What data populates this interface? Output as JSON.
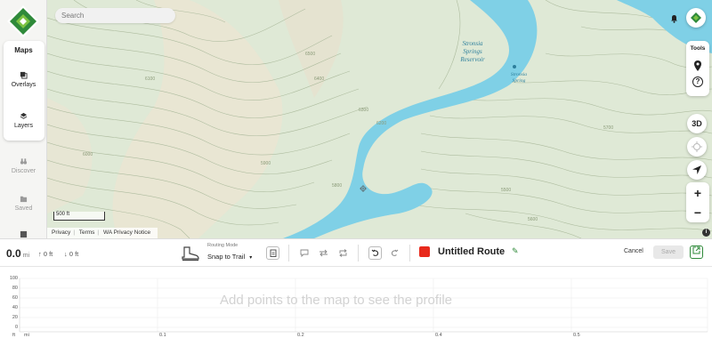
{
  "search": {
    "placeholder": "Search"
  },
  "left_rail": {
    "title": "Maps",
    "items": [
      {
        "label": "Overlays",
        "icon": "overlays-icon",
        "enabled": true
      },
      {
        "label": "Layers",
        "icon": "layers-icon",
        "enabled": true
      },
      {
        "label": "Discover",
        "icon": "binoculars-icon",
        "enabled": false
      },
      {
        "label": "Saved",
        "icon": "folder-icon",
        "enabled": false
      }
    ]
  },
  "map": {
    "tools_label": "Tools",
    "btn_3d": "3D",
    "lake_label_1": "Stronsia",
    "lake_label_2": "Springs",
    "lake_label_3": "Reservoir",
    "spring_label_1": "Stronsia",
    "spring_label_2": "Spring",
    "contours": [
      "6500",
      "6400",
      "6300",
      "6200",
      "6100",
      "6000",
      "5900",
      "5800",
      "5500",
      "5600",
      "5700"
    ],
    "scale_label": "500 ft",
    "footer_links": [
      "Privacy",
      "Terms",
      "WA Privacy Notice"
    ],
    "zoom_in": "+",
    "zoom_out": "−",
    "colors": {
      "water": "#7fd0e6",
      "land": "#dfe9d6",
      "contour": "#a9b89a",
      "brand": "#2f8a3a"
    }
  },
  "toolbar": {
    "distance_value": "0.0",
    "distance_unit": "mi",
    "gain": "0 ft",
    "loss": "0 ft",
    "routing_mode_label": "Routing Mode",
    "routing_mode_value": "Snap to Trail",
    "route_name": "Untitled Route",
    "route_color": "#e8291c",
    "cancel_label": "Cancel",
    "save_label": "Save"
  },
  "profile": {
    "empty_message": "Add points to the map to see the profile",
    "y_ticks": [
      "100",
      "80",
      "60",
      "40",
      "20",
      "0"
    ],
    "x_ticks": [
      "0.1",
      "0.2",
      "0.4",
      "0.5"
    ],
    "y_unit": "ft",
    "x_unit": "mi"
  }
}
